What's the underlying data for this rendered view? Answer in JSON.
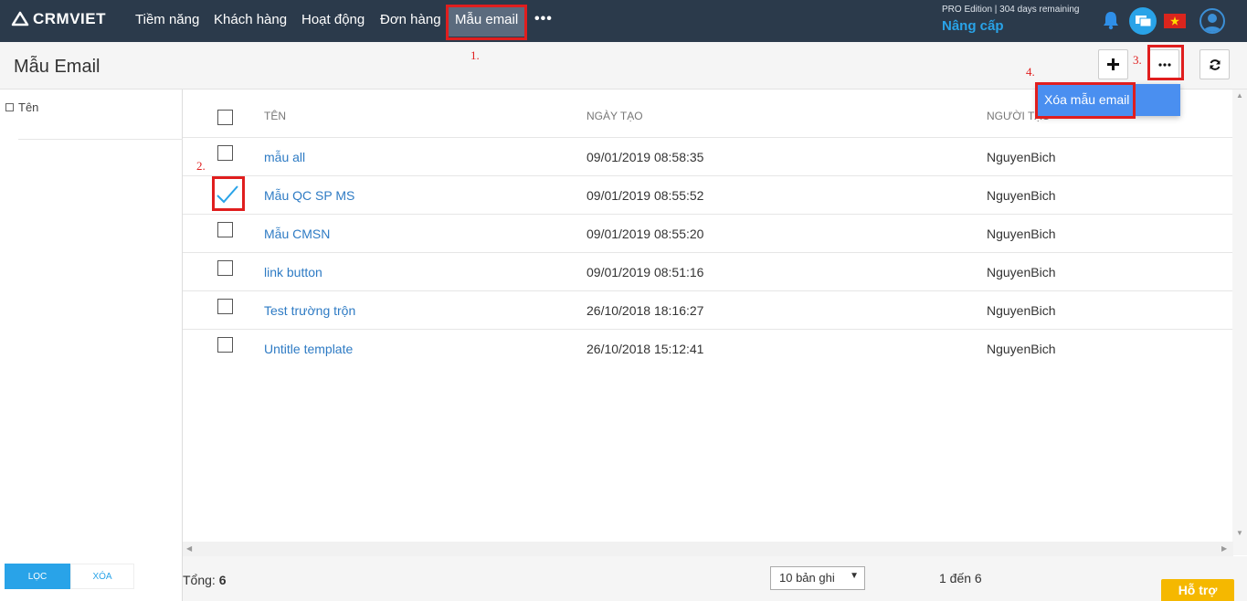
{
  "nav": {
    "logo_text": "CRMVIET",
    "items": [
      "Tiềm năng",
      "Khách hàng",
      "Hoạt động",
      "Đơn hàng",
      "Mẫu email"
    ],
    "more": "•••",
    "edition": "PRO Edition | 304 days remaining",
    "upgrade": "Nâng cấp"
  },
  "header": {
    "title": "Mẫu Email",
    "add_icon": "plus-icon",
    "more_icon": "ellipsis-icon",
    "refresh_icon": "refresh-icon"
  },
  "filter": {
    "name_label": "Tên",
    "apply_label": "LỌC",
    "clear_label": "XÓA"
  },
  "table": {
    "columns": [
      "TÊN",
      "NGÀY TẠO",
      "NGƯỜI TẠO"
    ],
    "rows": [
      {
        "name": "mẫu all",
        "created": "09/01/2019 08:58:35",
        "owner": "NguyenBich",
        "checked": false
      },
      {
        "name": "Mẫu QC SP MS",
        "created": "09/01/2019 08:55:52",
        "owner": "NguyenBich",
        "checked": true
      },
      {
        "name": "Mẫu CMSN",
        "created": "09/01/2019 08:55:20",
        "owner": "NguyenBich",
        "checked": false
      },
      {
        "name": "link button",
        "created": "09/01/2019 08:51:16",
        "owner": "NguyenBich",
        "checked": false
      },
      {
        "name": "Test trường trộn",
        "created": "26/10/2018 18:16:27",
        "owner": "NguyenBich",
        "checked": false
      },
      {
        "name": "Untitle template",
        "created": "26/10/2018 15:12:41",
        "owner": "NguyenBich",
        "checked": false
      }
    ]
  },
  "dropdown": {
    "delete_label": "Xóa mẫu email"
  },
  "footer": {
    "total_label": "Tổng:",
    "total_value": "6",
    "page_size": "10 bản ghi",
    "range": "1 đến 6",
    "support": "Hỗ trợ"
  },
  "annotations": [
    "1.",
    "2.",
    "3.",
    "4."
  ],
  "colors": {
    "nav_bg": "#2b3a4b",
    "accent": "#29a3e8",
    "link": "#2e7bc4",
    "annotation": "#e01e1e"
  }
}
